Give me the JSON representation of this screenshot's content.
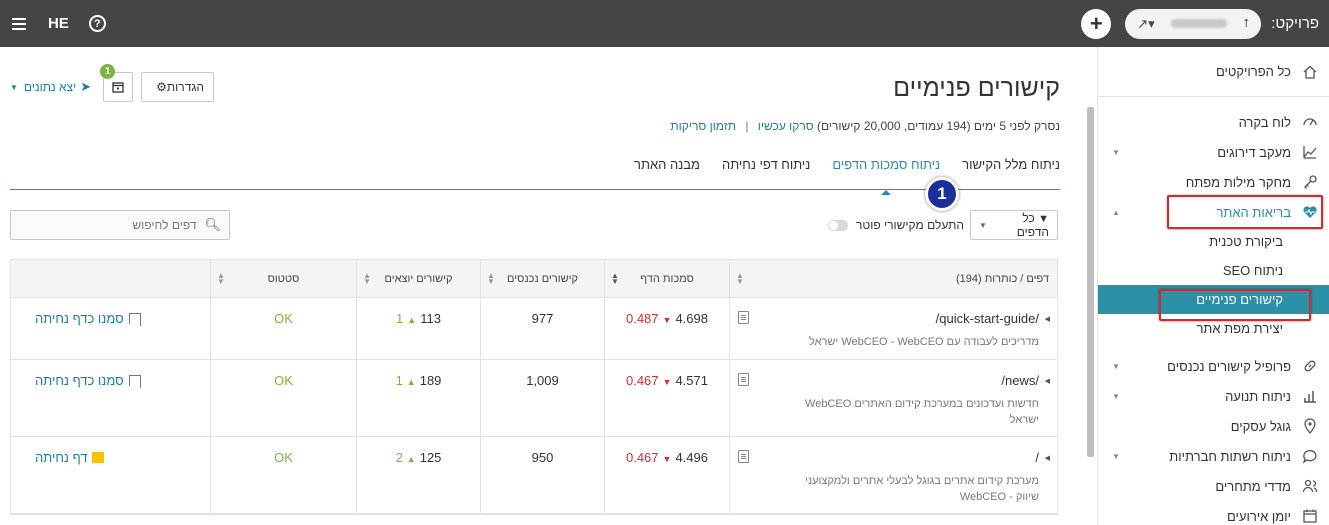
{
  "topbar": {
    "lang": "HE",
    "help": "?",
    "project_label": "פרויקט:",
    "plus": "+"
  },
  "sidebar": {
    "all_projects": "כל הפרויקטים",
    "items": [
      {
        "label": "לוח בקרה",
        "icon": "dashboard-icon"
      },
      {
        "label": "מעקב דירוגים",
        "icon": "trend-icon"
      },
      {
        "label": "מחקר מילות מפתח",
        "icon": "key-icon"
      },
      {
        "label": "בריאות האתר",
        "icon": "heart-pulse-icon"
      }
    ],
    "sub": [
      "ביקורת טכנית",
      "ניתוח SEO",
      "קישורים פנימיים",
      "יצירת מפת אתר"
    ],
    "items2": [
      {
        "label": "פרופיל קישורים נכנסים",
        "icon": "link-icon"
      },
      {
        "label": "ניתוח תנועה",
        "icon": "bar-chart-icon"
      },
      {
        "label": "גוגל עסקים",
        "icon": "map-pin-icon"
      },
      {
        "label": "ניתוח רשתות חברתיות",
        "icon": "chat-icon"
      },
      {
        "label": "מדדי מתחרים",
        "icon": "users-icon"
      },
      {
        "label": "יומן אירועים",
        "icon": "calendar-icon"
      }
    ]
  },
  "header": {
    "title": "קישורים פנימיים",
    "meta_text": "נסרק לפני 5 ימים  (194 עמודים, 20,000 קישורים)",
    "scan_now": "סרקו עכשיו",
    "sep": "|",
    "schedule_scans": "תזמון סריקות",
    "settings": "הגדרות",
    "export": "יצא נתונים",
    "badge": "1"
  },
  "tabs": [
    {
      "label": "ניתוח מלל הקישור",
      "active": false
    },
    {
      "label": "ניתוח סמכות הדפים",
      "active": true
    },
    {
      "label": "ניתוח דפי נחיתה",
      "active": false
    },
    {
      "label": "מבנה האתר",
      "active": false
    }
  ],
  "step_marker": "1",
  "filters": {
    "all_pages": "כל הדפים",
    "ignore_nofollow": "התעלם מקישורי פוטר",
    "search_placeholder": "דפים לחיפוש"
  },
  "table": {
    "headers": {
      "page": "דפים / כותרות (194)",
      "authority": "סמכות הדף",
      "incoming": "קישורים נכנסים",
      "outgoing": "קישורים יוצאים",
      "status": "סטטוס"
    },
    "rows": [
      {
        "url": "/quick-start-guide/",
        "desc": "מדריכים לעבודה עם WebCEO - WebCEO ישראל",
        "auth": "4.698",
        "auth_delta": "0.487",
        "incoming": "977",
        "outgoing": "113",
        "out_delta": "1",
        "status": "OK",
        "action": "סמנו כדף נחיתה",
        "flag": "empty"
      },
      {
        "url": "/news/",
        "desc": "חדשות ועדכונים במערכת קידום האתרים WebCEO ישראל",
        "auth": "4.571",
        "auth_delta": "0.467",
        "incoming": "1,009",
        "outgoing": "189",
        "out_delta": "1",
        "status": "OK",
        "action": "סמנו כדף נחיתה",
        "flag": "empty"
      },
      {
        "url": "/",
        "desc": "מערכת קידום אתרים בגוגל לבעלי אתרים ולמקצועני שיווק - WebCEO",
        "auth": "4.496",
        "auth_delta": "0.467",
        "incoming": "950",
        "outgoing": "125",
        "out_delta": "2",
        "status": "OK",
        "action": "דף נחיתה",
        "flag": "full"
      }
    ]
  },
  "colors": {
    "accent": "#2b8fa5",
    "topbar": "#454545",
    "ok": "#7cb342",
    "down": "#d32f2f",
    "highlight": "#d9262a"
  }
}
